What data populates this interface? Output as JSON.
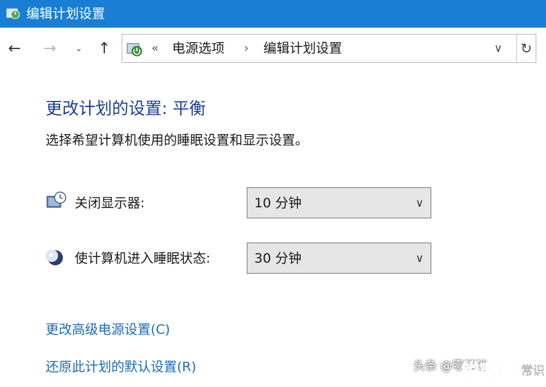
{
  "window": {
    "title": "编辑计划设置"
  },
  "nav": {
    "back_icon": "arrow-left",
    "forward_icon": "arrow-right",
    "recent_icon": "chevron-down",
    "up_icon": "arrow-up",
    "address": {
      "overflow": "«",
      "breadcrumbs": [
        "电源选项",
        "编辑计划设置"
      ],
      "separator": "›"
    },
    "refresh_icon": "refresh"
  },
  "main": {
    "heading": "更改计划的设置: 平衡",
    "subtitle": "选择希望计算机使用的睡眠设置和显示设置。",
    "settings": [
      {
        "label": "关闭显示器:",
        "value": "10 分钟",
        "icon": "monitor-clock-icon"
      },
      {
        "label": "使计算机进入睡眠状态:",
        "value": "30 分钟",
        "icon": "moon-icon"
      }
    ],
    "links": [
      "更改高级电源设置(C)",
      "还原此计划的默认设置(R)"
    ]
  },
  "watermark": {
    "text": "头条 @零基础",
    "logo_text": "锐客网",
    "trailing": "常识"
  },
  "colors": {
    "titlebar": "#1a7fd4",
    "heading": "#1e3f8f",
    "link": "#1a6bb5",
    "select_bg": "#e6e6e6"
  }
}
